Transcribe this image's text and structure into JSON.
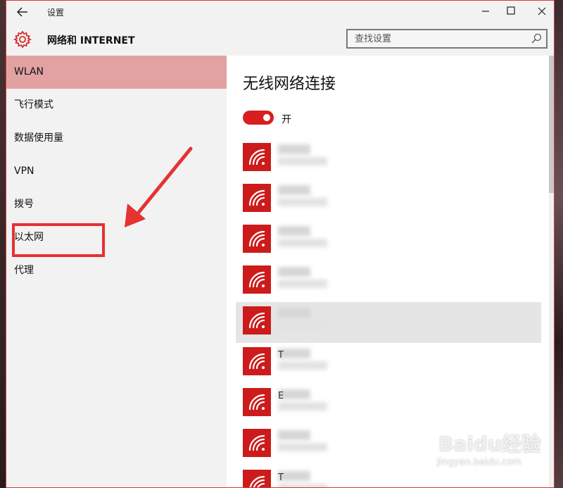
{
  "window": {
    "title": "设置",
    "back_icon": "arrow-left-icon",
    "minimize_icon": "minimize-icon",
    "maximize_icon": "maximize-icon",
    "close_icon": "close-icon"
  },
  "header": {
    "section_title": "网络和 INTERNET",
    "section_icon": "gear-icon",
    "search_placeholder": "查找设置",
    "search_icon": "search-icon",
    "accent_color": "#d81e1e"
  },
  "sidebar": {
    "items": [
      {
        "label": "WLAN",
        "active": true
      },
      {
        "label": "飞行模式"
      },
      {
        "label": "数据使用量"
      },
      {
        "label": "VPN"
      },
      {
        "label": "拨号"
      },
      {
        "label": "以太网"
      },
      {
        "label": "代理"
      }
    ],
    "active_color": "#e3a2a2"
  },
  "content": {
    "heading": "无线网络连接",
    "toggle_label": "开",
    "toggle_on": true,
    "networks": [
      {
        "name": "",
        "icon": "wifi-icon"
      },
      {
        "name": "",
        "icon": "wifi-icon"
      },
      {
        "name": "",
        "icon": "wifi-icon"
      },
      {
        "name": "",
        "icon": "wifi-icon"
      },
      {
        "name": "",
        "icon": "wifi-icon",
        "highlighted": true
      },
      {
        "name": "T",
        "icon": "wifi-icon"
      },
      {
        "name": "E",
        "icon": "wifi-icon"
      },
      {
        "name": "",
        "icon": "wifi-icon"
      },
      {
        "name": "T",
        "icon": "wifi-icon"
      }
    ]
  },
  "annotations": {
    "arrow_color": "#e53232",
    "highlighted_item": "以太网"
  },
  "watermark": {
    "main": "Baidu经验",
    "sub": "jingyan.baidu.com"
  }
}
